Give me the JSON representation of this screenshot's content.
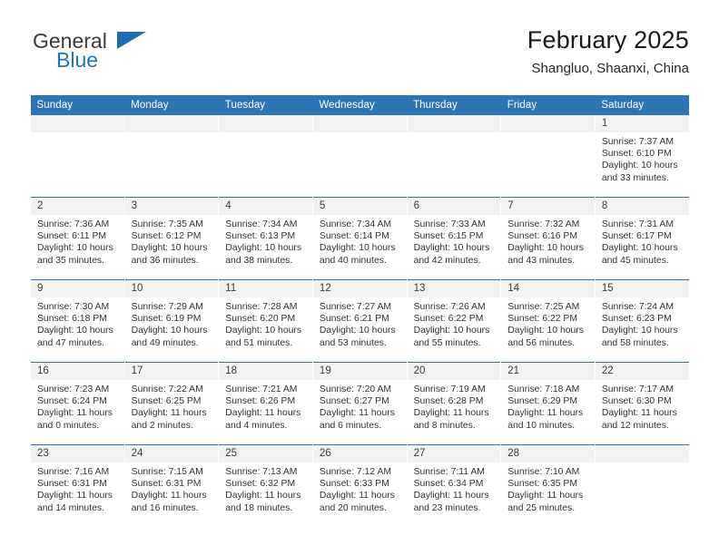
{
  "brand": {
    "name_part1": "General",
    "name_part2": "Blue",
    "flag_icon": "triangle-flag-icon"
  },
  "header": {
    "title": "February 2025",
    "location": "Shangluo, Shaanxi, China"
  },
  "theme": {
    "header_blue": "#2f75b5",
    "row_rule_blue": "#2f75b5",
    "daynum_band": "#f2f2f2",
    "brand_blue": "#1b75bb",
    "text": "#333333"
  },
  "weekdays": [
    "Sunday",
    "Monday",
    "Tuesday",
    "Wednesday",
    "Thursday",
    "Friday",
    "Saturday"
  ],
  "labels": {
    "sunrise": "Sunrise:",
    "sunset": "Sunset:",
    "daylight": "Daylight:"
  },
  "weeks": [
    [
      {
        "blank": true
      },
      {
        "blank": true
      },
      {
        "blank": true
      },
      {
        "blank": true
      },
      {
        "blank": true
      },
      {
        "blank": true
      },
      {
        "day": "1",
        "sunrise": "Sunrise: 7:37 AM",
        "sunset": "Sunset: 6:10 PM",
        "daylight1": "Daylight: 10 hours",
        "daylight2": "and 33 minutes."
      }
    ],
    [
      {
        "day": "2",
        "sunrise": "Sunrise: 7:36 AM",
        "sunset": "Sunset: 6:11 PM",
        "daylight1": "Daylight: 10 hours",
        "daylight2": "and 35 minutes."
      },
      {
        "day": "3",
        "sunrise": "Sunrise: 7:35 AM",
        "sunset": "Sunset: 6:12 PM",
        "daylight1": "Daylight: 10 hours",
        "daylight2": "and 36 minutes."
      },
      {
        "day": "4",
        "sunrise": "Sunrise: 7:34 AM",
        "sunset": "Sunset: 6:13 PM",
        "daylight1": "Daylight: 10 hours",
        "daylight2": "and 38 minutes."
      },
      {
        "day": "5",
        "sunrise": "Sunrise: 7:34 AM",
        "sunset": "Sunset: 6:14 PM",
        "daylight1": "Daylight: 10 hours",
        "daylight2": "and 40 minutes."
      },
      {
        "day": "6",
        "sunrise": "Sunrise: 7:33 AM",
        "sunset": "Sunset: 6:15 PM",
        "daylight1": "Daylight: 10 hours",
        "daylight2": "and 42 minutes."
      },
      {
        "day": "7",
        "sunrise": "Sunrise: 7:32 AM",
        "sunset": "Sunset: 6:16 PM",
        "daylight1": "Daylight: 10 hours",
        "daylight2": "and 43 minutes."
      },
      {
        "day": "8",
        "sunrise": "Sunrise: 7:31 AM",
        "sunset": "Sunset: 6:17 PM",
        "daylight1": "Daylight: 10 hours",
        "daylight2": "and 45 minutes."
      }
    ],
    [
      {
        "day": "9",
        "sunrise": "Sunrise: 7:30 AM",
        "sunset": "Sunset: 6:18 PM",
        "daylight1": "Daylight: 10 hours",
        "daylight2": "and 47 minutes."
      },
      {
        "day": "10",
        "sunrise": "Sunrise: 7:29 AM",
        "sunset": "Sunset: 6:19 PM",
        "daylight1": "Daylight: 10 hours",
        "daylight2": "and 49 minutes."
      },
      {
        "day": "11",
        "sunrise": "Sunrise: 7:28 AM",
        "sunset": "Sunset: 6:20 PM",
        "daylight1": "Daylight: 10 hours",
        "daylight2": "and 51 minutes."
      },
      {
        "day": "12",
        "sunrise": "Sunrise: 7:27 AM",
        "sunset": "Sunset: 6:21 PM",
        "daylight1": "Daylight: 10 hours",
        "daylight2": "and 53 minutes."
      },
      {
        "day": "13",
        "sunrise": "Sunrise: 7:26 AM",
        "sunset": "Sunset: 6:22 PM",
        "daylight1": "Daylight: 10 hours",
        "daylight2": "and 55 minutes."
      },
      {
        "day": "14",
        "sunrise": "Sunrise: 7:25 AM",
        "sunset": "Sunset: 6:22 PM",
        "daylight1": "Daylight: 10 hours",
        "daylight2": "and 56 minutes."
      },
      {
        "day": "15",
        "sunrise": "Sunrise: 7:24 AM",
        "sunset": "Sunset: 6:23 PM",
        "daylight1": "Daylight: 10 hours",
        "daylight2": "and 58 minutes."
      }
    ],
    [
      {
        "day": "16",
        "sunrise": "Sunrise: 7:23 AM",
        "sunset": "Sunset: 6:24 PM",
        "daylight1": "Daylight: 11 hours",
        "daylight2": "and 0 minutes."
      },
      {
        "day": "17",
        "sunrise": "Sunrise: 7:22 AM",
        "sunset": "Sunset: 6:25 PM",
        "daylight1": "Daylight: 11 hours",
        "daylight2": "and 2 minutes."
      },
      {
        "day": "18",
        "sunrise": "Sunrise: 7:21 AM",
        "sunset": "Sunset: 6:26 PM",
        "daylight1": "Daylight: 11 hours",
        "daylight2": "and 4 minutes."
      },
      {
        "day": "19",
        "sunrise": "Sunrise: 7:20 AM",
        "sunset": "Sunset: 6:27 PM",
        "daylight1": "Daylight: 11 hours",
        "daylight2": "and 6 minutes."
      },
      {
        "day": "20",
        "sunrise": "Sunrise: 7:19 AM",
        "sunset": "Sunset: 6:28 PM",
        "daylight1": "Daylight: 11 hours",
        "daylight2": "and 8 minutes."
      },
      {
        "day": "21",
        "sunrise": "Sunrise: 7:18 AM",
        "sunset": "Sunset: 6:29 PM",
        "daylight1": "Daylight: 11 hours",
        "daylight2": "and 10 minutes."
      },
      {
        "day": "22",
        "sunrise": "Sunrise: 7:17 AM",
        "sunset": "Sunset: 6:30 PM",
        "daylight1": "Daylight: 11 hours",
        "daylight2": "and 12 minutes."
      }
    ],
    [
      {
        "day": "23",
        "sunrise": "Sunrise: 7:16 AM",
        "sunset": "Sunset: 6:31 PM",
        "daylight1": "Daylight: 11 hours",
        "daylight2": "and 14 minutes."
      },
      {
        "day": "24",
        "sunrise": "Sunrise: 7:15 AM",
        "sunset": "Sunset: 6:31 PM",
        "daylight1": "Daylight: 11 hours",
        "daylight2": "and 16 minutes."
      },
      {
        "day": "25",
        "sunrise": "Sunrise: 7:13 AM",
        "sunset": "Sunset: 6:32 PM",
        "daylight1": "Daylight: 11 hours",
        "daylight2": "and 18 minutes."
      },
      {
        "day": "26",
        "sunrise": "Sunrise: 7:12 AM",
        "sunset": "Sunset: 6:33 PM",
        "daylight1": "Daylight: 11 hours",
        "daylight2": "and 20 minutes."
      },
      {
        "day": "27",
        "sunrise": "Sunrise: 7:11 AM",
        "sunset": "Sunset: 6:34 PM",
        "daylight1": "Daylight: 11 hours",
        "daylight2": "and 23 minutes."
      },
      {
        "day": "28",
        "sunrise": "Sunrise: 7:10 AM",
        "sunset": "Sunset: 6:35 PM",
        "daylight1": "Daylight: 11 hours",
        "daylight2": "and 25 minutes."
      },
      {
        "blank": true
      }
    ]
  ]
}
